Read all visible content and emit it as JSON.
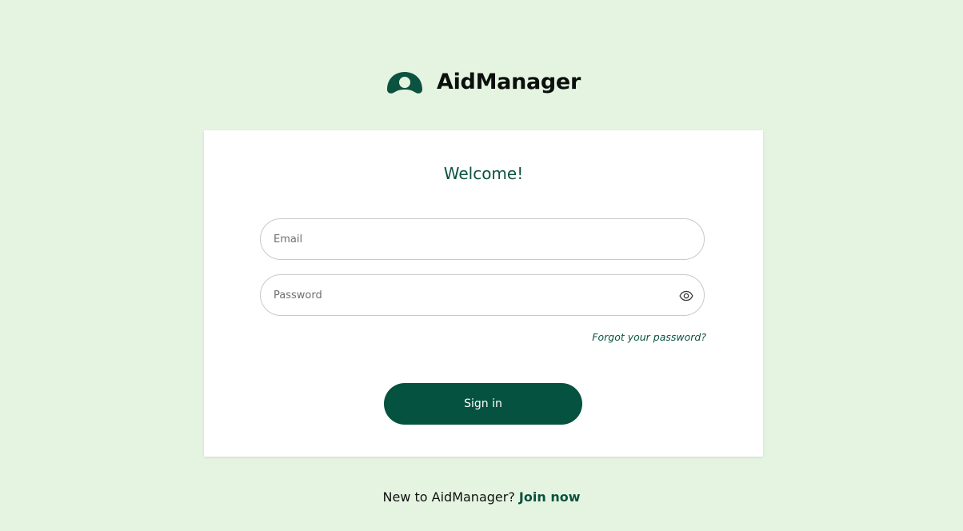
{
  "brand": {
    "name": "AidManager",
    "logo_icon": "aidmanager-logo-icon",
    "color": "#0b5240"
  },
  "login": {
    "welcome": "Welcome!",
    "email_placeholder": "Email",
    "email_value": "",
    "password_placeholder": "Password",
    "password_value": "",
    "toggle_icon": "eye-icon",
    "forgot_label": "Forgot your password?",
    "signin_label": "Sign in"
  },
  "footer": {
    "prompt": "New to AidManager?",
    "join_label": "Join now"
  },
  "colors": {
    "background": "#e5f4e0",
    "primary": "#04523f",
    "card": "#ffffff"
  }
}
